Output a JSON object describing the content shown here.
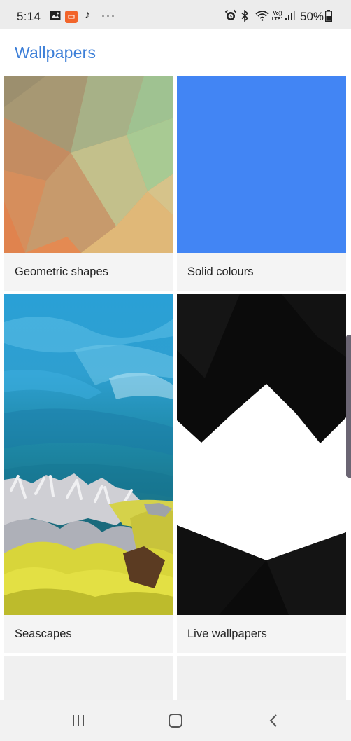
{
  "status_bar": {
    "time": "5:14",
    "battery_percent": "50%",
    "network_label_top": "Vo))",
    "network_label_bottom": "LTE1",
    "notification_icons": [
      "gallery-icon",
      "app-notification-icon",
      "music-note-icon",
      "more-dots-icon"
    ],
    "system_icons": [
      "alarm-icon",
      "bluetooth-icon",
      "wifi-icon",
      "lte-icon",
      "signal-icon",
      "battery-icon"
    ]
  },
  "header": {
    "title": "Wallpapers",
    "title_color": "#3d7fd8"
  },
  "categories": [
    {
      "label": "Geometric shapes"
    },
    {
      "label": "Solid colours",
      "color": "#4285f4"
    },
    {
      "label": "Seascapes"
    },
    {
      "label": "Live wallpapers"
    }
  ],
  "navigation": {
    "buttons": [
      "recent-apps-icon",
      "home-icon",
      "back-icon"
    ]
  }
}
